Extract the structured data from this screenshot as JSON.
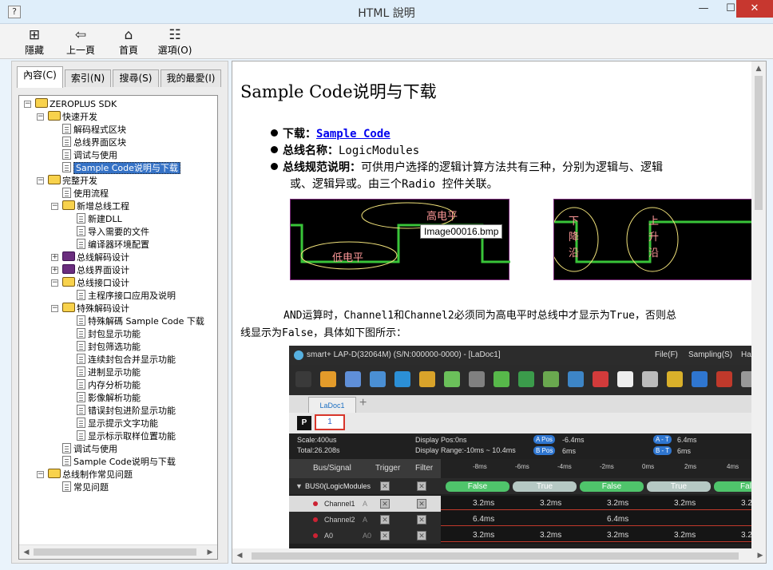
{
  "window": {
    "title": "HTML 說明",
    "min": "—",
    "max": "☐",
    "close": "✕"
  },
  "toolbar": [
    {
      "label": "隱藏",
      "icon": "hide-icon",
      "glyph": "⊞"
    },
    {
      "label": "上一頁",
      "icon": "back-arrow-icon",
      "glyph": "⇦"
    },
    {
      "label": "首頁",
      "icon": "home-icon",
      "glyph": "⌂"
    },
    {
      "label": "選項(O)",
      "icon": "options-icon",
      "glyph": "☷"
    }
  ],
  "tabs": [
    "內容(C)",
    "索引(N)",
    "搜尋(S)",
    "我的最愛(I)"
  ],
  "tree": [
    {
      "label": "ZEROPLUS SDK",
      "type": "book-open",
      "depth": 0,
      "exp": "−"
    },
    {
      "label": "快速开发",
      "type": "book-open",
      "depth": 1,
      "exp": "−"
    },
    {
      "label": "解码程式区块",
      "type": "page",
      "depth": 2
    },
    {
      "label": "总线界面区块",
      "type": "page",
      "depth": 2
    },
    {
      "label": "调试与使用",
      "type": "page",
      "depth": 2
    },
    {
      "label": "Sample Code说明与下载",
      "type": "page",
      "depth": 2,
      "selected": true
    },
    {
      "label": "完整开发",
      "type": "book-open",
      "depth": 1,
      "exp": "−"
    },
    {
      "label": "使用流程",
      "type": "page",
      "depth": 2
    },
    {
      "label": "新增总线工程",
      "type": "book-open",
      "depth": 2,
      "exp": "−"
    },
    {
      "label": "新建DLL",
      "type": "page",
      "depth": 3
    },
    {
      "label": "导入需要的文件",
      "type": "page",
      "depth": 3
    },
    {
      "label": "编译器环境配置",
      "type": "page",
      "depth": 3
    },
    {
      "label": "总线解码设计",
      "type": "book-closed",
      "depth": 2,
      "exp": "+"
    },
    {
      "label": "总线界面设计",
      "type": "book-closed",
      "depth": 2,
      "exp": "+"
    },
    {
      "label": "总线接口设计",
      "type": "book-open",
      "depth": 2,
      "exp": "−"
    },
    {
      "label": "主程序接口应用及说明",
      "type": "page",
      "depth": 3
    },
    {
      "label": "特殊解码设计",
      "type": "book-open",
      "depth": 2,
      "exp": "−"
    },
    {
      "label": "特殊解碼 Sample Code 下载",
      "type": "page",
      "depth": 3
    },
    {
      "label": "封包显示功能",
      "type": "page",
      "depth": 3
    },
    {
      "label": "封包筛选功能",
      "type": "page",
      "depth": 3
    },
    {
      "label": "连续封包合并显示功能",
      "type": "page",
      "depth": 3
    },
    {
      "label": "进制显示功能",
      "type": "page",
      "depth": 3
    },
    {
      "label": "内存分析功能",
      "type": "page",
      "depth": 3
    },
    {
      "label": "影像解析功能",
      "type": "page",
      "depth": 3
    },
    {
      "label": "错误封包进阶显示功能",
      "type": "page",
      "depth": 3
    },
    {
      "label": "显示提示文字功能",
      "type": "page",
      "depth": 3
    },
    {
      "label": "显示标示取样位置功能",
      "type": "page",
      "depth": 3
    },
    {
      "label": "调试与使用",
      "type": "page",
      "depth": 2
    },
    {
      "label": "Sample Code说明与下载",
      "type": "page",
      "depth": 2
    },
    {
      "label": "总线制作常见问题",
      "type": "book-open",
      "depth": 1,
      "exp": "−"
    },
    {
      "label": "常见问题",
      "type": "page",
      "depth": 2
    }
  ],
  "doc": {
    "heading": "Sample Code说明与下载",
    "b1_label": "下载：",
    "b1_link": "Sample Code",
    "b2_label": "总线名称：",
    "b2_value": "LogicModules",
    "b3_label": "总线规范说明：",
    "b3_text1": "可供用户选择的逻辑计算方法共有三种，分别为逻辑与、逻辑",
    "b3_text2": "或、逻辑异或。由三个Radio 控件关联。",
    "img1_high": "高电平",
    "img1_low": "低电平",
    "tooltip": "Image00016.bmp",
    "img2_fall": [
      "下",
      "降",
      "沿"
    ],
    "img2_rise": [
      "上",
      "升",
      "沿"
    ],
    "para1": "AND运算时，Channel1和Channel2必须同为高电平时总线中才显示为True，否则总",
    "para2": "线显示为False，具体如下图所示："
  },
  "app": {
    "title": "smart+  LAP-D(32064M) (S/N:000000-0000) - [LaDoc1]",
    "menu": [
      "File(F)",
      "Sampling(S)",
      "Hardw"
    ],
    "doc_tab": "LaDoc1",
    "page_btn": "P",
    "page_num": "1",
    "scale": "Scale:400us",
    "total": "Total:26.208s",
    "pos": "Display Pos:0ns",
    "range": "Display Range:-10ms ~ 10.4ms",
    "a_pos": "A Pos",
    "a_val": "-6.4ms",
    "b_pos": "B Pos",
    "b_val": "6ms",
    "at": "A - T",
    "at_val": "6.4ms",
    "bt": "B - T",
    "bt_val": "6ms",
    "headers": [
      "Bus/Signal",
      "Trigger",
      "Filter"
    ],
    "ticks": [
      "-8ms",
      "-6ms",
      "-4ms",
      "-2ms",
      "0ms",
      "2ms",
      "4ms"
    ],
    "bus": {
      "name": "BUS0(LogicModules",
      "values": [
        "False",
        "True",
        "False",
        "True",
        "Fal"
      ]
    },
    "rows": [
      {
        "name": "Channel1",
        "alias": "A",
        "vals": [
          "3.2ms",
          "3.2ms",
          "3.2ms",
          "3.2ms",
          "3.2"
        ]
      },
      {
        "name": "Channel2",
        "alias": "A",
        "vals": [
          "6.4ms",
          "6.4ms"
        ]
      },
      {
        "name": "A0",
        "alias": "A0",
        "vals": [
          "3.2ms",
          "3.2ms",
          "3.2ms",
          "3.2ms",
          "3.2"
        ]
      }
    ]
  }
}
